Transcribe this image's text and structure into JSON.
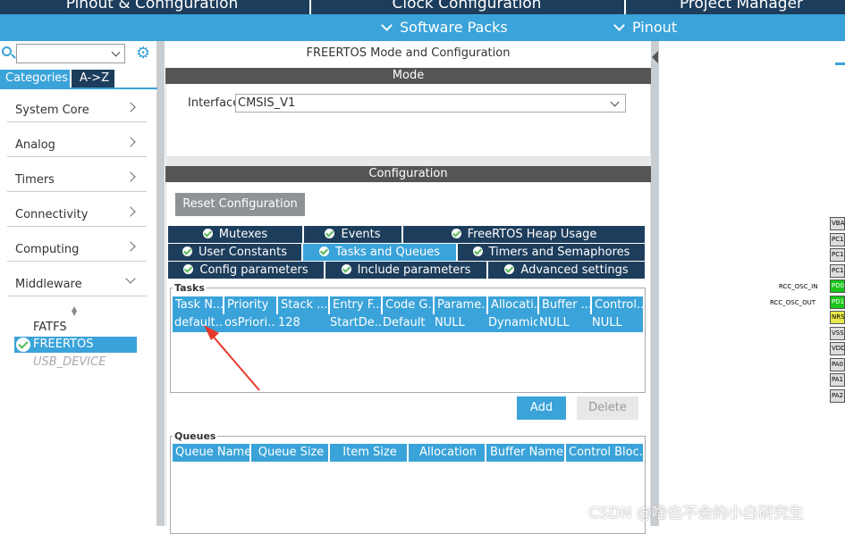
{
  "top_tabs": [
    "Pinout & Configuration",
    "Clock Configuration",
    "Project Manager"
  ],
  "sub_menu": [
    "Software Packs",
    "Pinout"
  ],
  "left": {
    "search_value": "",
    "tab_categories": "Categories",
    "tab_az": "A->Z",
    "categories": [
      "System Core",
      "Analog",
      "Timers",
      "Connectivity",
      "Computing",
      "Middleware"
    ],
    "middleware_items": [
      "FATFS",
      "FREERTOS",
      "USB_DEVICE"
    ],
    "selected": "FREERTOS"
  },
  "mid": {
    "title": "FREERTOS Mode and Configuration",
    "mode_header": "Mode",
    "interface_label": "Interface",
    "interface_value": "CMSIS_V1",
    "config_header": "Configuration",
    "reset_label": "Reset Configuration",
    "tabs_row1": [
      "Mutexes",
      "Events",
      "FreeRTOS Heap Usage"
    ],
    "tabs_row2": [
      "User Constants",
      "Tasks and Queues",
      "Timers and Semaphores"
    ],
    "tabs_row3": [
      "Config parameters",
      "Include parameters",
      "Advanced settings"
    ],
    "active_tab": "Tasks and Queues",
    "tasks_label": "Tasks",
    "task_columns": [
      "Task N...",
      "Priority",
      "Stack ...",
      "Entry F...",
      "Code G...",
      "Parame...",
      "Allocati...",
      "Buffer ...",
      "Control..."
    ],
    "task_rows": [
      [
        "default...",
        "osPriori...",
        "128",
        "StartDe...",
        "Default",
        "NULL",
        "Dynamic",
        "NULL",
        "NULL"
      ]
    ],
    "add_label": "Add",
    "delete_label": "Delete",
    "queues_label": "Queues",
    "queue_columns": [
      "Queue Name",
      "Queue Size",
      "Item Size",
      "Allocation",
      "Buffer Name",
      "Control Bloc..."
    ]
  },
  "pinout": {
    "pins": [
      "VBA",
      "PC1",
      "PC1",
      "PC1",
      "PD0",
      "PD1",
      "NRS",
      "VSS",
      "VDD",
      "PA0",
      "PA1",
      "PA2"
    ],
    "labels": [
      "RCC_OSC_IN",
      "RCC_OSC_OUT"
    ]
  },
  "watermark": "CSDN @啥也不会的小白研究生",
  "colors": {
    "accent": "#3aa3d9",
    "dark": "#1d3d5c",
    "section": "#555555",
    "green": "#5cb85c",
    "arrow": "#e8392c"
  }
}
